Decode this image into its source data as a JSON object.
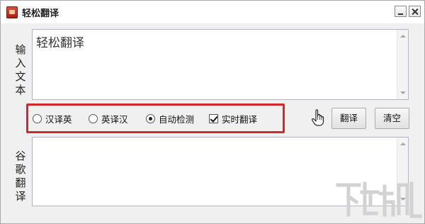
{
  "window": {
    "title": "轻松翻译"
  },
  "input_section": {
    "label": "输入文本",
    "text": "轻松翻译"
  },
  "options": [
    {
      "label": "汉译英",
      "type": "radio",
      "checked": false
    },
    {
      "label": "英译汉",
      "type": "radio",
      "checked": false
    },
    {
      "label": "自动检测",
      "type": "radio",
      "checked": true
    },
    {
      "label": "实时翻译",
      "type": "checkbox",
      "checked": true
    }
  ],
  "buttons": {
    "translate": "翻译",
    "clear": "清空"
  },
  "output_section": {
    "label": "谷歌翻译",
    "text": ""
  },
  "colors": {
    "highlight": "#d9262b",
    "window_bg": "#f0f0f0"
  },
  "icons": [
    "app-icon",
    "minimize-icon",
    "close-icon",
    "hand-pointer-icon",
    "watermark-logo"
  ]
}
